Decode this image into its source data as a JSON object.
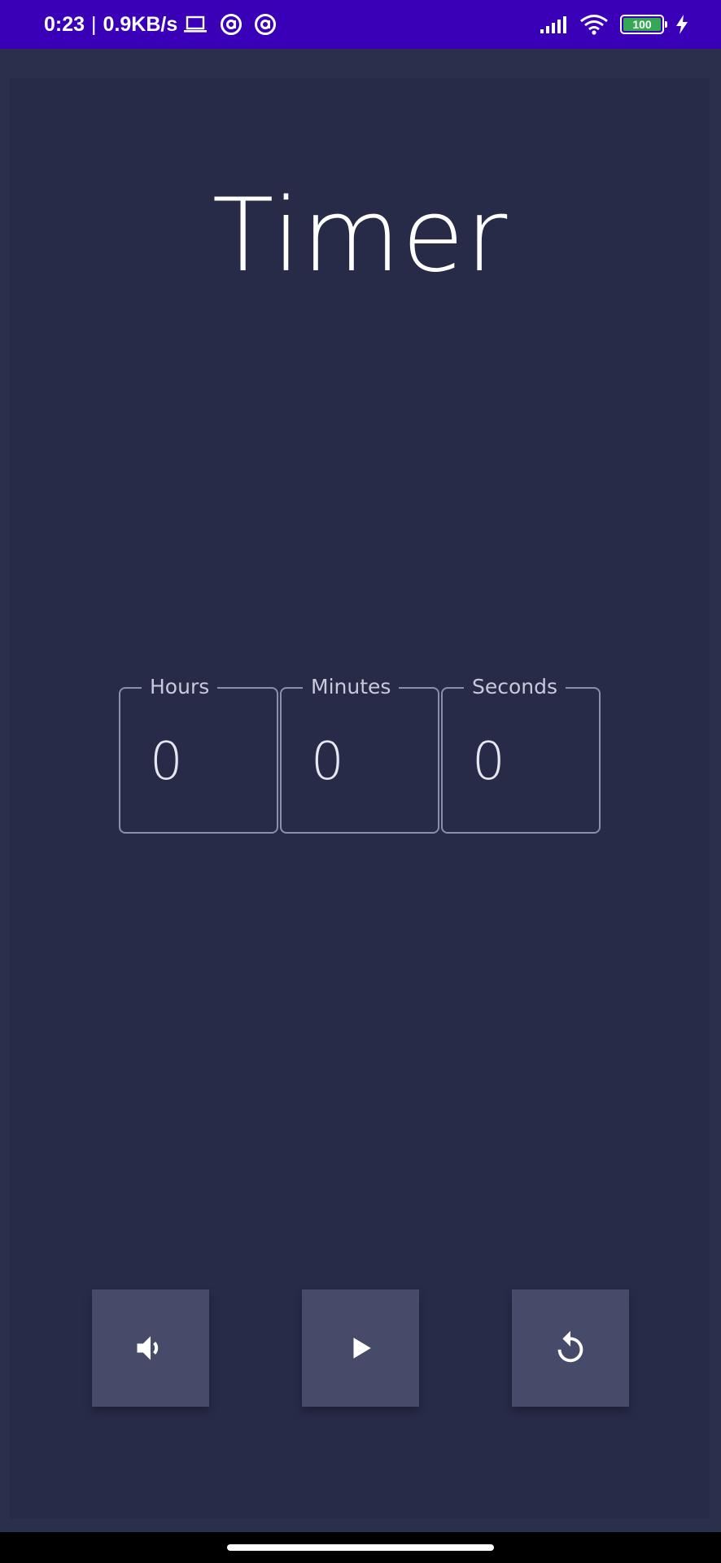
{
  "status_bar": {
    "time": "0:23",
    "separator": "|",
    "net_speed": "0.9KB/s",
    "battery_level": "100",
    "icons": [
      "laptop-icon",
      "at-sign-icon",
      "at-sign-icon",
      "signal-icon",
      "wifi-icon",
      "battery-icon",
      "charging-icon"
    ]
  },
  "app": {
    "title": "Timer",
    "fields": [
      {
        "label": "Hours",
        "value": "0"
      },
      {
        "label": "Minutes",
        "value": "0"
      },
      {
        "label": "Seconds",
        "value": "0"
      }
    ],
    "controls": [
      "volume-icon",
      "play-icon",
      "reset-icon"
    ]
  },
  "colors": {
    "status_bar": "#3a00b8",
    "background": "#272b48",
    "button": "#464b6a",
    "field_border": "#8c8fa8",
    "text": "#ffffff",
    "battery": "#34a853"
  }
}
